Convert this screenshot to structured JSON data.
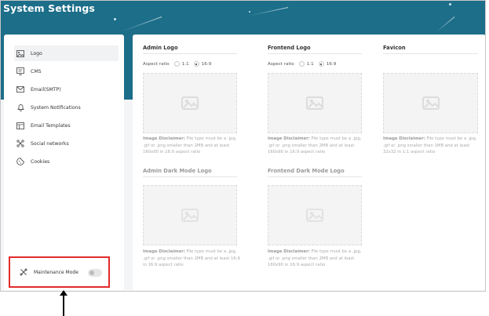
{
  "header": {
    "title": "System Settings"
  },
  "sidebar": {
    "items": [
      {
        "label": "Logo",
        "icon": "image-icon",
        "active": true
      },
      {
        "label": "CMS",
        "icon": "monitor-icon",
        "active": false
      },
      {
        "label": "Email(SMTP)",
        "icon": "mail-icon",
        "active": false
      },
      {
        "label": "System Notifications",
        "icon": "bell-icon",
        "active": false
      },
      {
        "label": "Email Templates",
        "icon": "template-icon",
        "active": false
      },
      {
        "label": "Social networks",
        "icon": "share-icon",
        "active": false
      },
      {
        "label": "Cookies",
        "icon": "cookie-icon",
        "active": false
      }
    ],
    "maintenance": {
      "label": "Maintenance Mode",
      "enabled": false
    }
  },
  "main": {
    "admin_logo": {
      "title": "Admin Logo",
      "aspect_label": "Aspect ratio",
      "options": [
        "1:1",
        "16:9"
      ],
      "selected": "16:9",
      "disclaimer_strong": "Image Disclaimer:",
      "disclaimer_text": " File type must be a .jpg, .gif or .png smaller than 2MB and at least 160x90 in 16:9 aspect ratio"
    },
    "frontend_logo": {
      "title": "Frontend Logo",
      "aspect_label": "Aspect ratio",
      "options": [
        "1:1",
        "16:9"
      ],
      "selected": "16:9",
      "disclaimer_strong": "Image Disclaimer:",
      "disclaimer_text": " File type must be a .jpg, .gif or .png smaller than 2MB and at least 160x90 in 16:9 aspect ratio"
    },
    "favicon": {
      "title": "Favicon",
      "disclaimer_strong": "Image Disclaimer:",
      "disclaimer_text": " File type must be a .jpg, .gif or .png smaller than 1MB and at least 32x32 in 1:1 aspect ratio"
    },
    "admin_dark_logo": {
      "title": "Admin Dark Mode Logo",
      "disclaimer_strong": "Image Disclaimer:",
      "disclaimer_text": " File type must be a .jpg, .gif or .png smaller than 2MB and at least 16:9 in 16:9 aspect ratio"
    },
    "frontend_dark_logo": {
      "title": "Frontend Dark Mode Logo",
      "disclaimer_strong": "Image Disclaimer:",
      "disclaimer_text": " File type must be a .jpg, .gif or .png smaller than 2MB and at least 160x90 in 16:9 aspect ratio"
    }
  },
  "colors": {
    "header": "#1c6e89",
    "highlight": "#e32b2b"
  }
}
